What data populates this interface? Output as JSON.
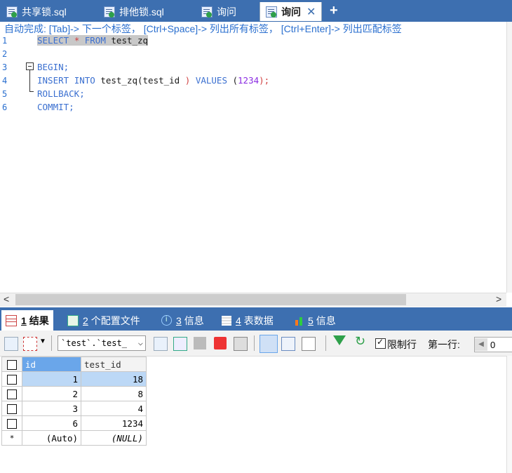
{
  "tabs": [
    {
      "label": "共享锁.sql",
      "active": false
    },
    {
      "label": "排他锁.sql",
      "active": false
    },
    {
      "label": "询问",
      "active": false
    },
    {
      "label": "询问",
      "active": true
    }
  ],
  "new_tab_symbol": "+",
  "close_symbol": "✕",
  "editor": {
    "hint": "自动完成: [Tab]-> 下一个标签， [Ctrl+Space]-> 列出所有标签， [Ctrl+Enter]-> 列出匹配标签",
    "line_numbers": [
      "1",
      "2",
      "3",
      "4",
      "5",
      "6"
    ],
    "lines": {
      "l1": {
        "kw1": "SELECT",
        "star": "*",
        "kw2": "FROM",
        "rest": "test_zq"
      },
      "l3": {
        "kw": "BEGIN;"
      },
      "l4": {
        "kw1": "INSERT",
        "kw2": "INTO",
        "mid": "test_zq(test_id",
        "paren": ")",
        "kw3": "VALUES",
        "lp": "(",
        "num": "1234",
        "rp": ");"
      },
      "l5": {
        "kw": "ROLLBACK;"
      },
      "l6": {
        "kw": "COMMIT;"
      }
    },
    "scroll_left": "<",
    "scroll_right": ">"
  },
  "result_tabs": [
    {
      "num": "1",
      "label": "结果",
      "icon": "grid-icon",
      "active": true
    },
    {
      "num": "2",
      "label": "个配置文件",
      "icon": "profile-icon"
    },
    {
      "num": "3",
      "label": "信息",
      "icon": "info-icon"
    },
    {
      "num": "4",
      "label": "表数据",
      "icon": "table-icon"
    },
    {
      "num": "5",
      "label": "信息",
      "icon": "bar-chart-icon"
    }
  ],
  "toolbar": {
    "table_select": "`test`.`test_",
    "limit_label": "限制行",
    "limit_checked": true,
    "first_row_label": "第一行:",
    "first_row_value": "0"
  },
  "grid": {
    "columns": [
      "id",
      "test_id"
    ],
    "rows": [
      {
        "id": "1",
        "test_id": "18"
      },
      {
        "id": "2",
        "test_id": "8"
      },
      {
        "id": "3",
        "test_id": "4"
      },
      {
        "id": "6",
        "test_id": "1234"
      }
    ],
    "new_row": {
      "marker": "*",
      "id": "(Auto)",
      "test_id": "(NULL)"
    }
  },
  "colors": {
    "accent": "#3d6fb0",
    "keyword": "#3a6fd0",
    "selection": "#bcd8f6"
  }
}
